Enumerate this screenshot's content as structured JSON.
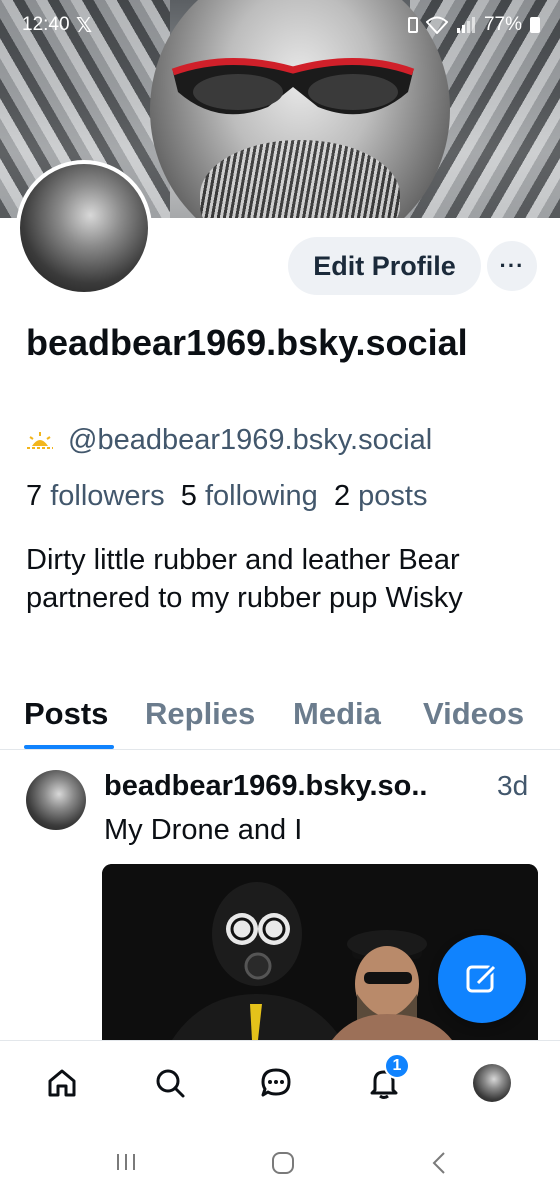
{
  "status_bar": {
    "time": "12:40",
    "battery": "77%"
  },
  "profile": {
    "edit_button": "Edit Profile",
    "more_button": "···",
    "display_name": "beadbear1969.bsky.social",
    "handle": "@beadbear1969.bsky.social",
    "stats": {
      "followers_count": "7",
      "followers_label": "followers",
      "following_count": "5",
      "following_label": "following",
      "posts_count": "2",
      "posts_label": "posts"
    },
    "bio": "Dirty little rubber and leather Bear partnered to my rubber pup Wisky"
  },
  "tabs": [
    {
      "label": "Posts",
      "active": true
    },
    {
      "label": "Replies",
      "active": false
    },
    {
      "label": "Media",
      "active": false
    },
    {
      "label": "Videos",
      "active": false
    }
  ],
  "post": {
    "author": "beadbear1969.bsky.so..",
    "time": "3d",
    "text": "My Drone and I"
  },
  "bottom_nav": {
    "items": [
      "home-icon",
      "search-icon",
      "chat-icon",
      "notifications-icon",
      "profile-avatar"
    ],
    "notification_badge": "1"
  },
  "colors": {
    "accent": "#1083fe",
    "muted": "#42576c"
  }
}
